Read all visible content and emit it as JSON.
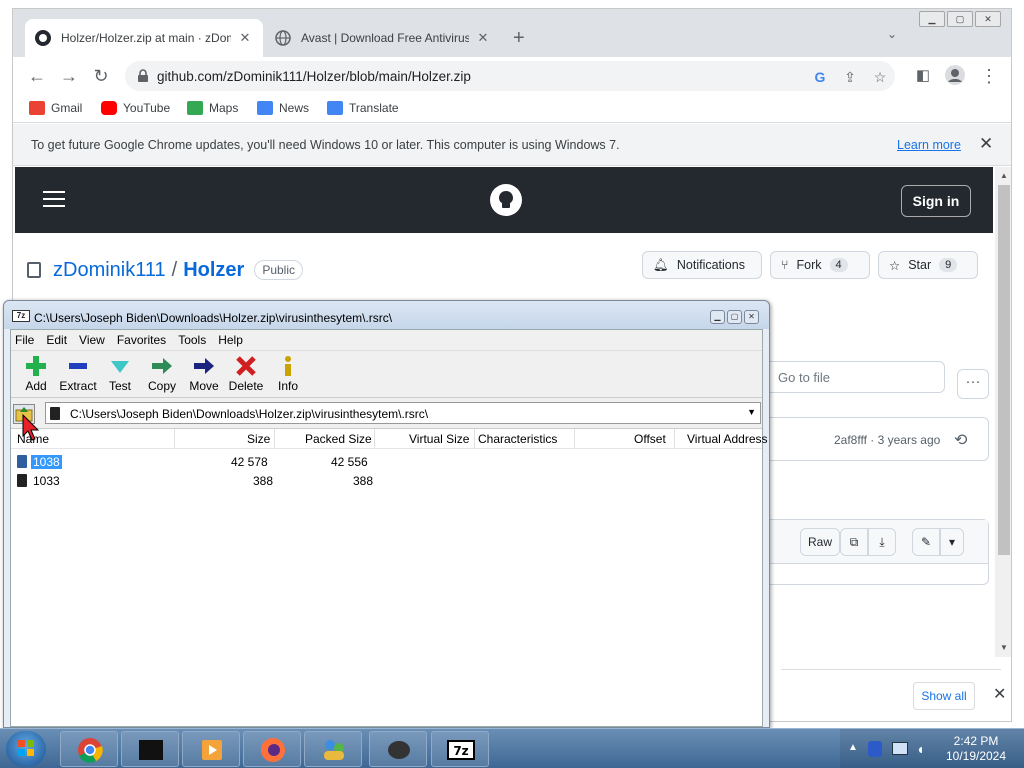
{
  "browser": {
    "tabs": [
      {
        "title": "Holzer/Holzer.zip at main · zDom",
        "active": true
      },
      {
        "title": "Avast | Download Free Antivirus &",
        "active": false
      }
    ],
    "url": "github.com/zDominik111/Holzer/blob/main/Holzer.zip",
    "bookmarks": [
      "Gmail",
      "YouTube",
      "Maps",
      "News",
      "Translate"
    ],
    "infobar": {
      "message": "To get future Google Chrome updates, you'll need Windows 10 or later. This computer is using Windows 7.",
      "link": "Learn more"
    }
  },
  "github": {
    "signin": "Sign in",
    "owner": "zDominik111",
    "slash": "/",
    "repo": "Holzer",
    "visibility": "Public",
    "notifications": "Notifications",
    "fork": "Fork",
    "fork_count": "4",
    "star": "Star",
    "star_count": "9",
    "go_to_file": "Go to file",
    "commit_meta": "2af8fff · 3 years ago",
    "raw": "Raw",
    "show_all": "Show all"
  },
  "sevenzip": {
    "title": "C:\\Users\\Joseph Biden\\Downloads\\Holzer.zip\\virusinthesytem\\.rsrc\\",
    "menu": [
      "File",
      "Edit",
      "View",
      "Favorites",
      "Tools",
      "Help"
    ],
    "toolbar": [
      "Add",
      "Extract",
      "Test",
      "Copy",
      "Move",
      "Delete",
      "Info"
    ],
    "path": "C:\\Users\\Joseph Biden\\Downloads\\Holzer.zip\\virusinthesytem\\.rsrc\\",
    "columns": [
      "Name",
      "Size",
      "Packed Size",
      "Virtual Size",
      "Characteristics",
      "Offset",
      "Virtual Address"
    ],
    "rows": [
      {
        "name": "1038",
        "size": "42 578",
        "packed": "42 556",
        "selected": true
      },
      {
        "name": "1033",
        "size": "388",
        "packed": "388",
        "selected": false
      }
    ]
  },
  "taskbar": {
    "time": "2:42 PM",
    "date": "10/19/2024"
  },
  "colors": {
    "github_header": "#24292f",
    "link_blue": "#0969da",
    "selection": "#3399ff",
    "taskbar": "#3e6794"
  }
}
